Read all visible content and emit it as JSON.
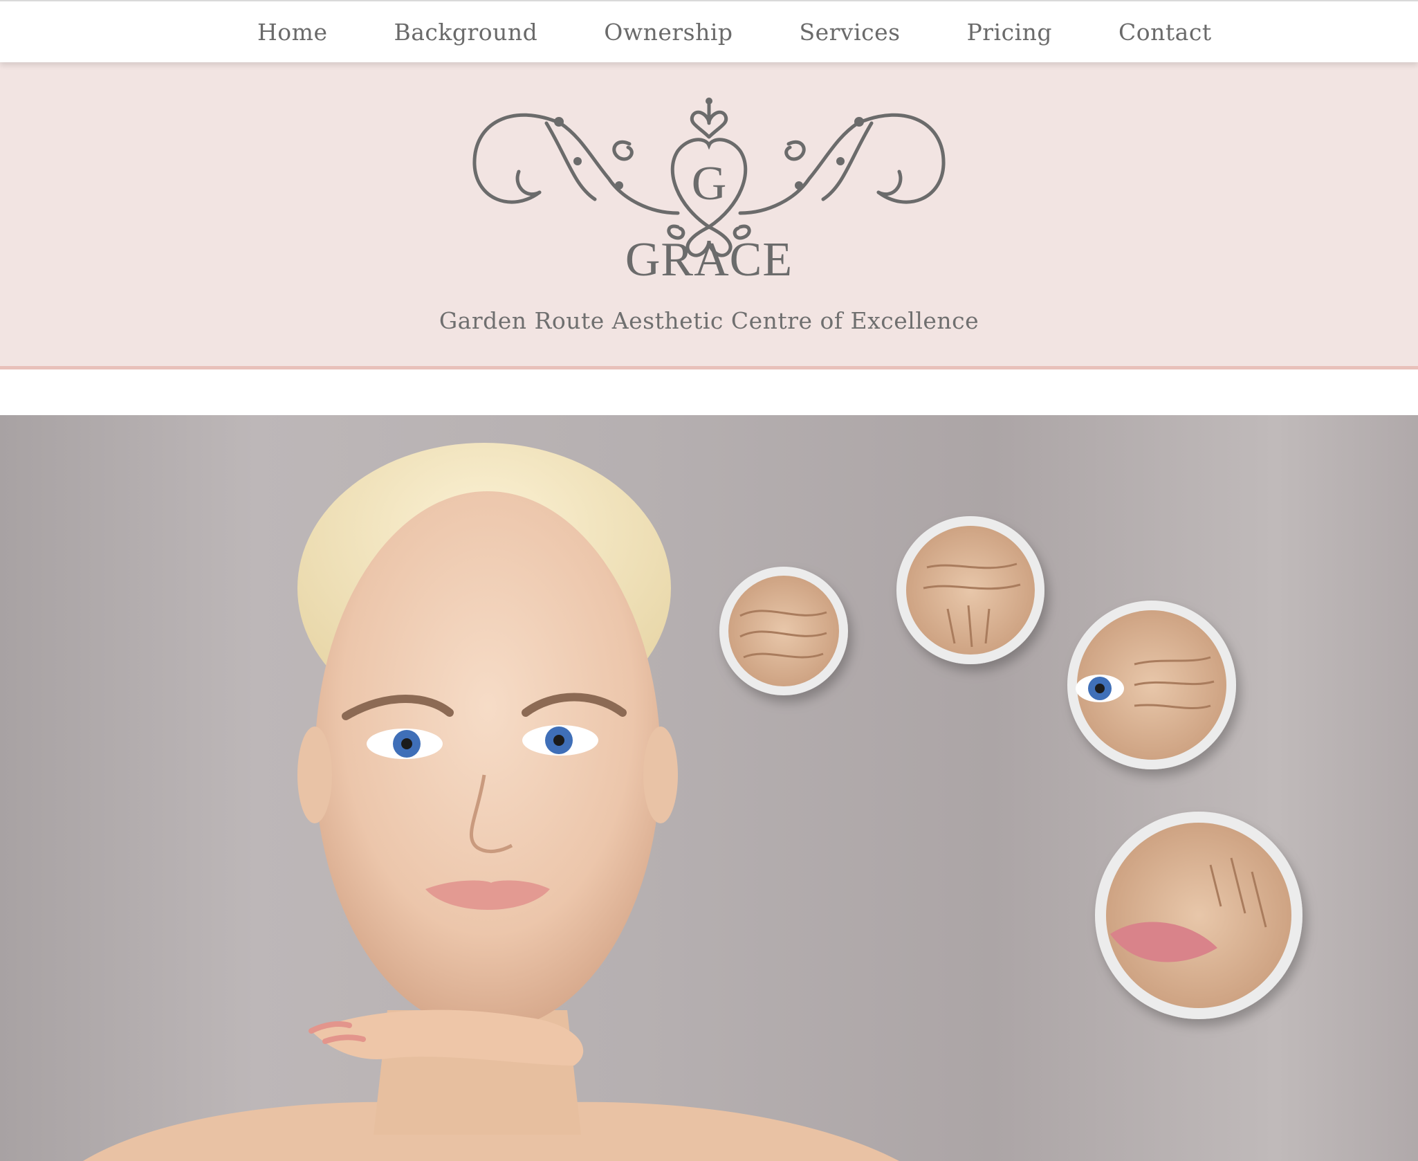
{
  "nav": {
    "items": [
      "Home",
      "Background",
      "Ownership",
      "Services",
      "Pricing",
      "Contact"
    ]
  },
  "brand": {
    "logo_letter": "G",
    "name": "GRACE",
    "tagline": "Garden Route Aesthetic Centre of Excellence"
  },
  "colors": {
    "nav_text": "#6a6a6a",
    "band_background": "#f2e4e2",
    "band_border": "#e8c0ba",
    "logo_gray": "#6b6b6b"
  },
  "hero": {
    "image": "woman-portrait-with-skin-closeup-circles",
    "closeups": [
      "forehead-wrinkles",
      "brow-wrinkles",
      "eye-crows-feet",
      "lip-wrinkles"
    ]
  }
}
